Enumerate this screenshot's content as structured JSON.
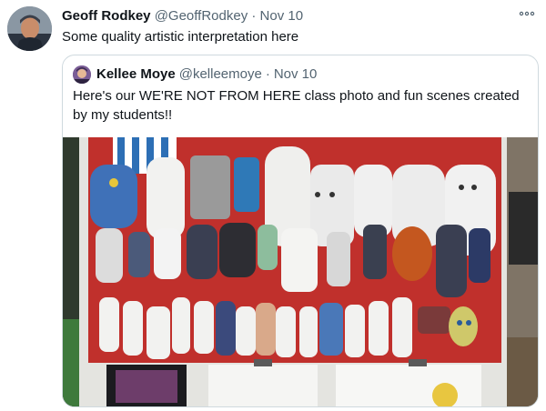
{
  "tweet": {
    "author_name": "Geoff Rodkey",
    "author_handle": "@GeoffRodkey",
    "separator": "·",
    "date": "Nov 10",
    "text": "Some quality artistic interpretation here",
    "more_icon": "ellipsis-icon"
  },
  "quoted_tweet": {
    "author_name": "Kellee Moye",
    "author_handle": "@kelleemoye",
    "separator": "·",
    "date": "Nov 10",
    "text": "Here's our WE'RE NOT FROM HERE class photo and fun scenes created by my students!!"
  },
  "colors": {
    "text_primary": "#0f1419",
    "text_secondary": "#536471",
    "border": "#cfd9de",
    "poster_red": "#c0302c",
    "floor_green": "#3e7a3c"
  }
}
